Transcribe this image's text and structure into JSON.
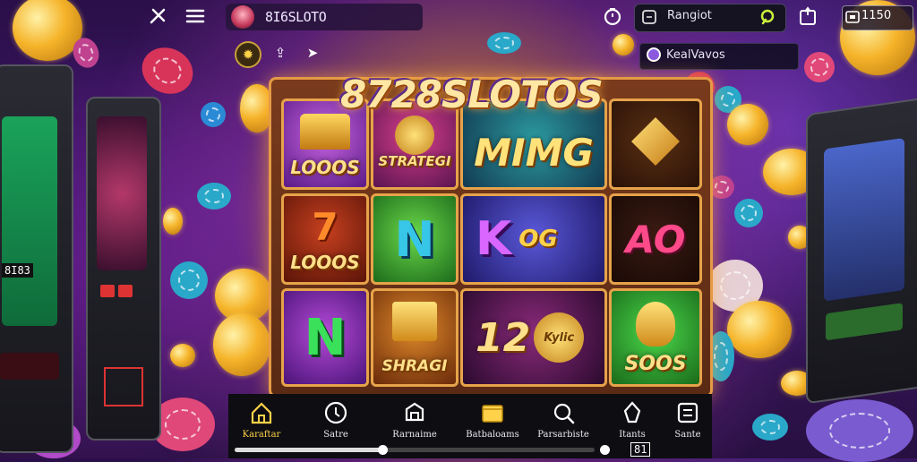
{
  "header": {
    "app_title": "8I6SLOTO",
    "search_text": "Rangiot",
    "wallet_text": "1150",
    "user_name": "KealVavos"
  },
  "game": {
    "logo_text": "8728SLOTOS",
    "progress": 0.41,
    "page_indicator": "81",
    "tiles": [
      {
        "label": "LOOOS"
      },
      {
        "label": "STRATEGI"
      },
      {
        "label": "MIMG"
      },
      {
        "label": ""
      },
      {
        "label": "LOOOS"
      },
      {
        "label": "N"
      },
      {
        "label": "K"
      },
      {
        "label": "AO"
      },
      {
        "label": "N"
      },
      {
        "label": "SHRAGI"
      },
      {
        "label": "12"
      },
      {
        "label": "SOOS"
      }
    ],
    "tile_extras": {
      "og": "OG",
      "kylic": "Kylic"
    }
  },
  "arcade": {
    "left_counter": "8I83"
  },
  "nav": {
    "items": [
      {
        "label": "Karaftar",
        "icon": "home-icon"
      },
      {
        "label": "Satre",
        "icon": "clock-icon"
      },
      {
        "label": "Rarnaime",
        "icon": "game-icon"
      },
      {
        "label": "Batbaloams",
        "icon": "folder-icon"
      },
      {
        "label": "Parsarbiste",
        "icon": "search-icon"
      },
      {
        "label": "Itants",
        "icon": "star-icon"
      },
      {
        "label": "Sante",
        "icon": "settings-icon"
      }
    ]
  },
  "colors": {
    "accent": "#ffd24a",
    "tile_frame": "#e6a34a",
    "search_icon": "#c9f03a"
  }
}
